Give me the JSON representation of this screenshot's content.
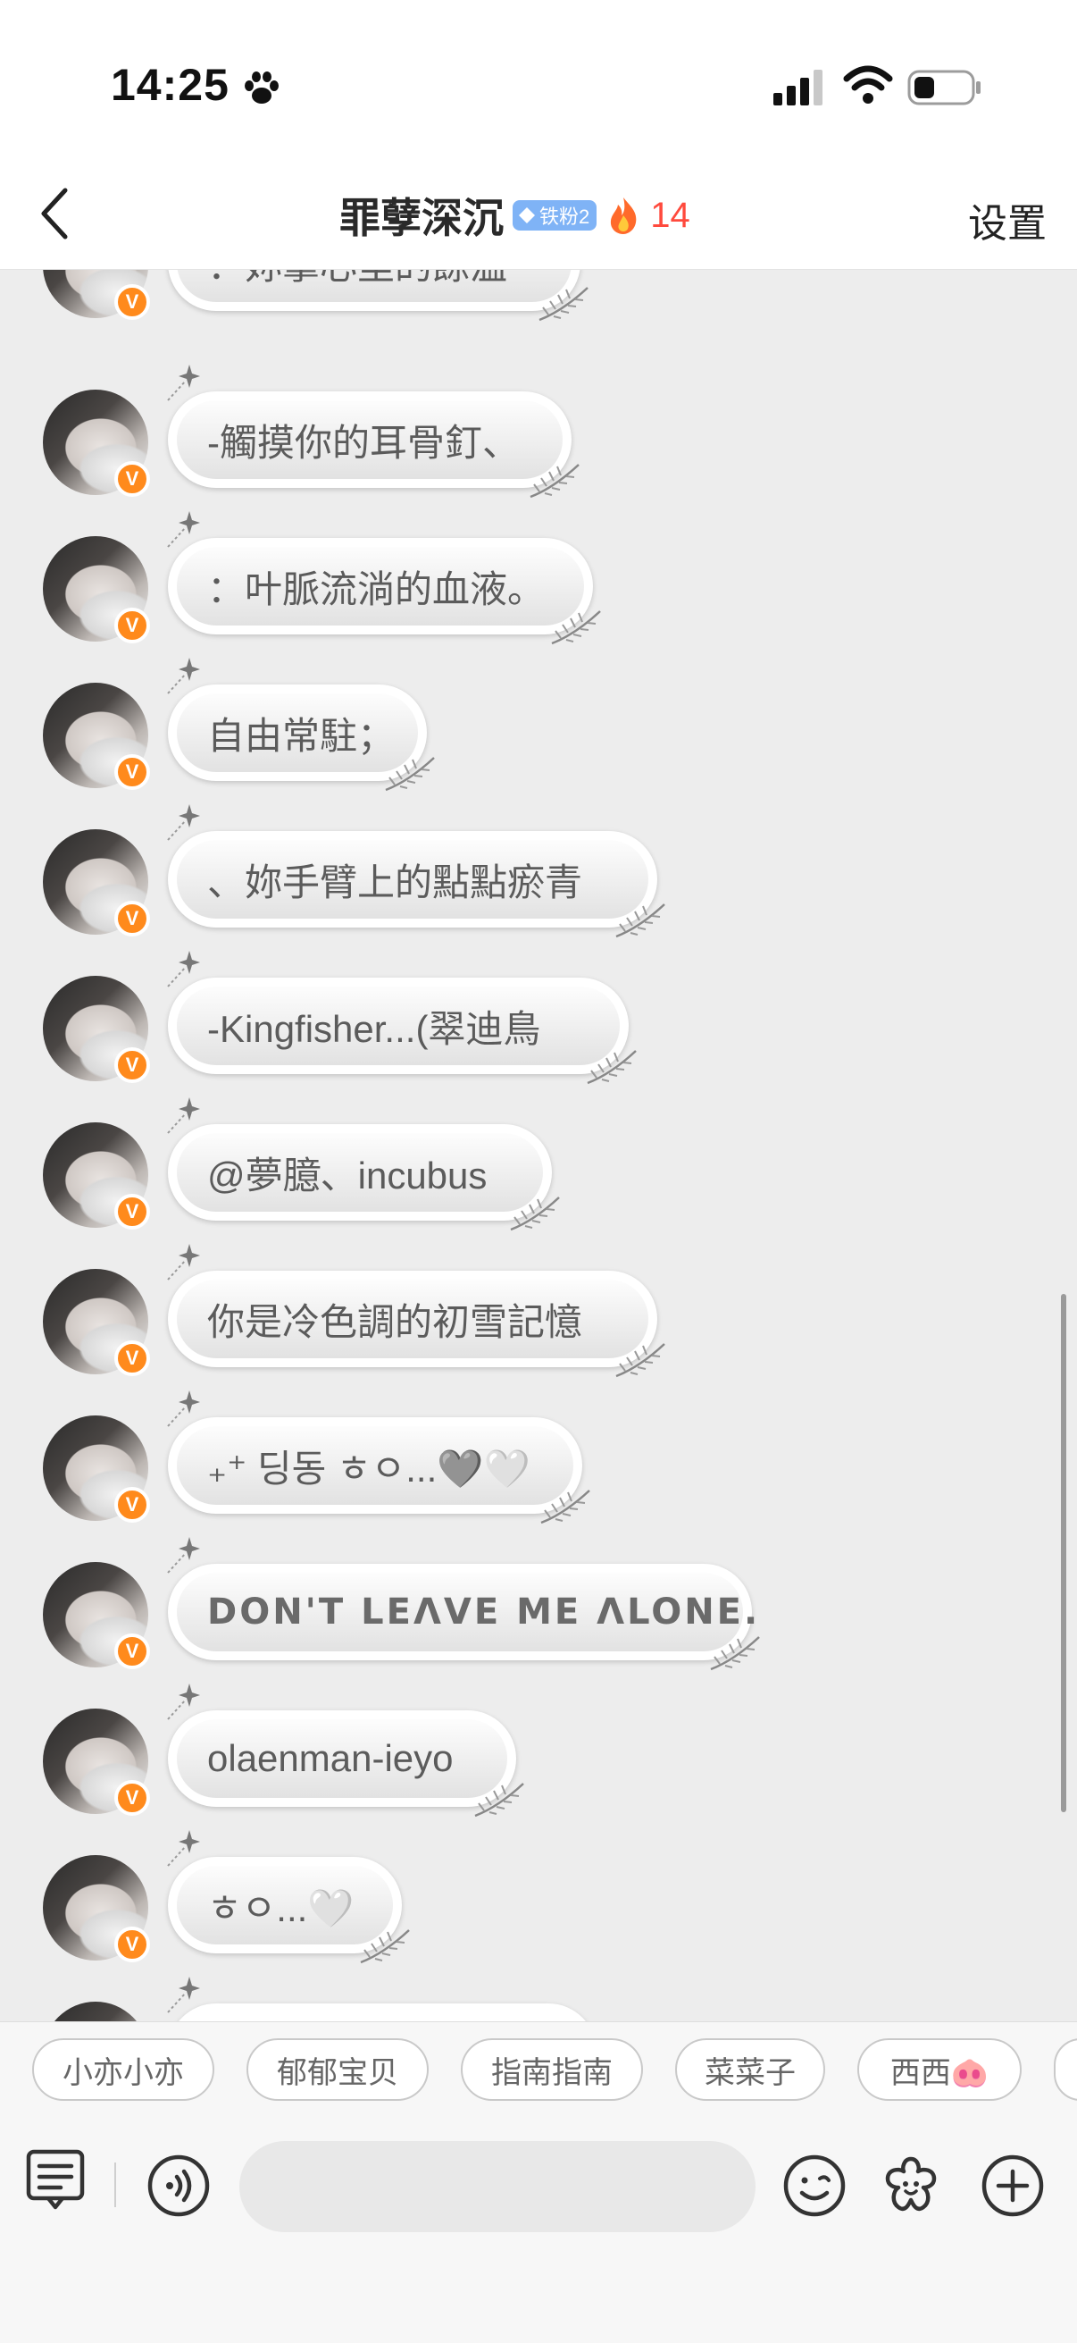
{
  "status_bar": {
    "time": "14:25"
  },
  "nav": {
    "title": "罪孽深沉",
    "fan_badge": "铁粉2",
    "fire_count": "14",
    "settings_label": "设置"
  },
  "messages": [
    {
      "text": "：妳掌心里的餘溫"
    },
    {
      "text": "-觸摸你的耳骨釘、"
    },
    {
      "text": "：叶脈流淌的血液。"
    },
    {
      "text": "自由常駐；"
    },
    {
      "text": "、妳手臂上的點點瘀青"
    },
    {
      "text": "-Kingfisher...(翠迪鳥"
    },
    {
      "text": "@夢臆、incubus"
    },
    {
      "text": "你是冷色調的初雪記憶"
    },
    {
      "text": "₊⁺ 딩동 ㅎㅇ...🩶🤍"
    },
    {
      "text": "DON'T LEΛVE ME ΛLONE."
    },
    {
      "text": "olaenman-ieyo"
    },
    {
      "text": "ㅎㅇ...🤍"
    }
  ],
  "avatar_badge": "V",
  "quick_replies": [
    "小亦小亦",
    "郁郁宝贝",
    "指南指南",
    "菜菜子",
    "西西🐽"
  ],
  "colors": {
    "accent_fire": "#ff4a3d",
    "fan_badge": "#7fb3f6",
    "verified": "#ff8a1c",
    "background": "#ededed"
  },
  "icons": {
    "back": "chevron-left-icon",
    "menu": "keyboard-menu-icon",
    "voice": "voice-icon",
    "emoji": "emoji-icon",
    "sticker": "flower-sticker-icon",
    "add": "plus-circle-icon"
  }
}
